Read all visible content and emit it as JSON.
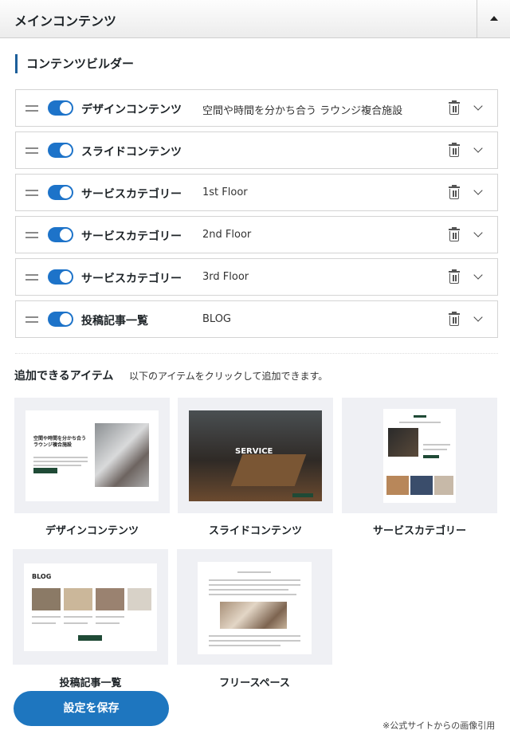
{
  "header": {
    "title": "メインコンテンツ"
  },
  "builder": {
    "title": "コンテンツビルダー",
    "rows": [
      {
        "name": "デザインコンテンツ",
        "sub": "空間や時間を分かち合う ラウンジ複合施設"
      },
      {
        "name": "スライドコンテンツ",
        "sub": ""
      },
      {
        "name": "サービスカテゴリー",
        "sub": "1st Floor"
      },
      {
        "name": "サービスカテゴリー",
        "sub": "2nd Floor"
      },
      {
        "name": "サービスカテゴリー",
        "sub": "3rd Floor"
      },
      {
        "name": "投稿記事一覧",
        "sub": "BLOG"
      }
    ]
  },
  "add_items": {
    "title": "追加できるアイテム",
    "description": "以下のアイテムをクリックして追加できます。",
    "items": [
      {
        "label": "デザインコンテンツ"
      },
      {
        "label": "スライドコンテンツ"
      },
      {
        "label": "サービスカテゴリー"
      },
      {
        "label": "投稿記事一覧"
      },
      {
        "label": "フリースペース"
      }
    ],
    "thumb_text": {
      "design_heading": "空間や時間を分かち合う ラウンジ複合施設",
      "slide_heading": "SERVICE",
      "blog_heading": "BLOG"
    }
  },
  "save_label": "設定を保存",
  "credit": "※公式サイトからの画像引用",
  "colors": {
    "accent": "#1e76bf",
    "toggle": "#1d73c9",
    "card_bg": "#eff0f4"
  },
  "icons": {
    "drag": "drag-handle-icon",
    "delete": "trash-icon",
    "expand": "chevron-down-icon",
    "collapse": "triangle-up-icon"
  }
}
